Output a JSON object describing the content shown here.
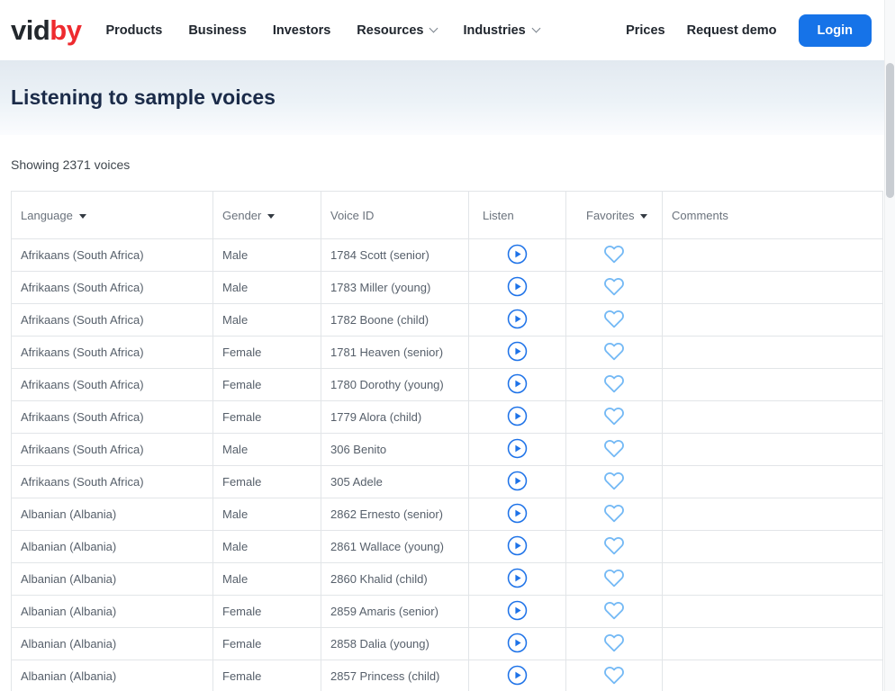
{
  "nav": {
    "logo": {
      "dark": "vid",
      "red": "by"
    },
    "items": [
      {
        "label": "Products",
        "has_dropdown": false
      },
      {
        "label": "Business",
        "has_dropdown": false
      },
      {
        "label": "Investors",
        "has_dropdown": false
      },
      {
        "label": "Resources",
        "has_dropdown": true
      },
      {
        "label": "Industries",
        "has_dropdown": true
      }
    ],
    "prices_label": "Prices",
    "request_demo_label": "Request demo",
    "login_label": "Login"
  },
  "hero": {
    "title": "Listening to sample voices"
  },
  "summary": {
    "text": "Showing 2371 voices"
  },
  "table": {
    "columns": [
      {
        "label": "Language",
        "sortable": true
      },
      {
        "label": "Gender",
        "sortable": true
      },
      {
        "label": "Voice ID",
        "sortable": false
      },
      {
        "label": "Listen",
        "sortable": false
      },
      {
        "label": "Favorites",
        "sortable": true
      },
      {
        "label": "Comments",
        "sortable": false
      }
    ],
    "rows": [
      {
        "language": "Afrikaans (South Africa)",
        "gender": "Male",
        "voice_id": "1784 Scott (senior)",
        "comment": ""
      },
      {
        "language": "Afrikaans (South Africa)",
        "gender": "Male",
        "voice_id": "1783 Miller (young)",
        "comment": ""
      },
      {
        "language": "Afrikaans (South Africa)",
        "gender": "Male",
        "voice_id": "1782 Boone (child)",
        "comment": ""
      },
      {
        "language": "Afrikaans (South Africa)",
        "gender": "Female",
        "voice_id": "1781 Heaven (senior)",
        "comment": ""
      },
      {
        "language": "Afrikaans (South Africa)",
        "gender": "Female",
        "voice_id": "1780 Dorothy (young)",
        "comment": ""
      },
      {
        "language": "Afrikaans (South Africa)",
        "gender": "Female",
        "voice_id": "1779 Alora (child)",
        "comment": ""
      },
      {
        "language": "Afrikaans (South Africa)",
        "gender": "Male",
        "voice_id": "306 Benito",
        "comment": ""
      },
      {
        "language": "Afrikaans (South Africa)",
        "gender": "Female",
        "voice_id": "305 Adele",
        "comment": ""
      },
      {
        "language": "Albanian (Albania)",
        "gender": "Male",
        "voice_id": "2862 Ernesto (senior)",
        "comment": ""
      },
      {
        "language": "Albanian (Albania)",
        "gender": "Male",
        "voice_id": "2861 Wallace (young)",
        "comment": ""
      },
      {
        "language": "Albanian (Albania)",
        "gender": "Male",
        "voice_id": "2860 Khalid (child)",
        "comment": ""
      },
      {
        "language": "Albanian (Albania)",
        "gender": "Female",
        "voice_id": "2859 Amaris (senior)",
        "comment": ""
      },
      {
        "language": "Albanian (Albania)",
        "gender": "Female",
        "voice_id": "2858 Dalia (young)",
        "comment": ""
      },
      {
        "language": "Albanian (Albania)",
        "gender": "Female",
        "voice_id": "2857 Princess (child)",
        "comment": ""
      }
    ]
  },
  "icons": {
    "listen": "play-circle-icon",
    "favorite": "heart-outline-icon",
    "sort": "sort-desc-arrow-icon",
    "nav_dropdown": "chevron-down-icon"
  },
  "colors": {
    "accent_blue": "#1673e8",
    "logo_red": "#ee2b2f",
    "logo_dark": "#23282d",
    "play_blue": "#1d72e8",
    "heart_blue": "#74b9f5",
    "title_navy": "#1b2b49"
  }
}
